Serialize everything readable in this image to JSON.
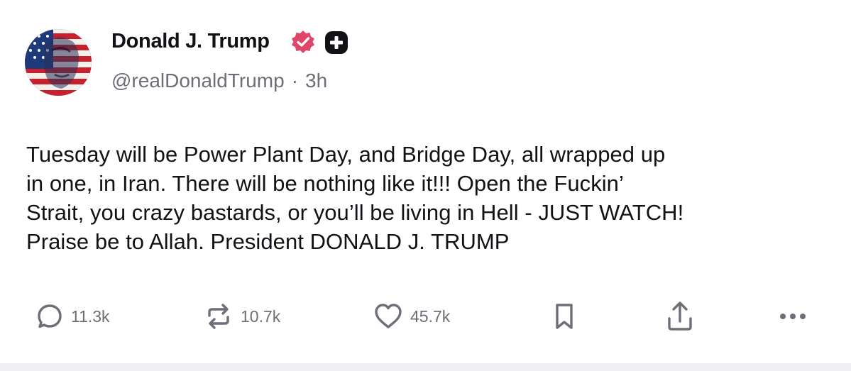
{
  "post": {
    "author": {
      "display_name": "Donald J. Trump",
      "handle": "@realDonaldTrump",
      "separator": "·",
      "timestamp": "3h",
      "avatar_icon": "avatar-flag-portrait",
      "verified_icon": "verified-badge-icon",
      "plus_icon": "plus-badge-icon"
    },
    "text": "Tuesday will be Power Plant Day, and Bridge Day, all wrapped up\nin one, in Iran. There will be nothing like it!!! Open the Fuckin’\nStrait, you crazy bastards, or you’ll be living in Hell - JUST WATCH!\nPraise be to Allah. President DONALD J. TRUMP",
    "actions": {
      "replies": "11.3k",
      "reposts": "10.7k",
      "likes": "45.7k"
    }
  },
  "colors": {
    "text": "#111116",
    "muted": "#6e6e78",
    "verified": "#e0466a",
    "plus_badge": "#111116"
  }
}
